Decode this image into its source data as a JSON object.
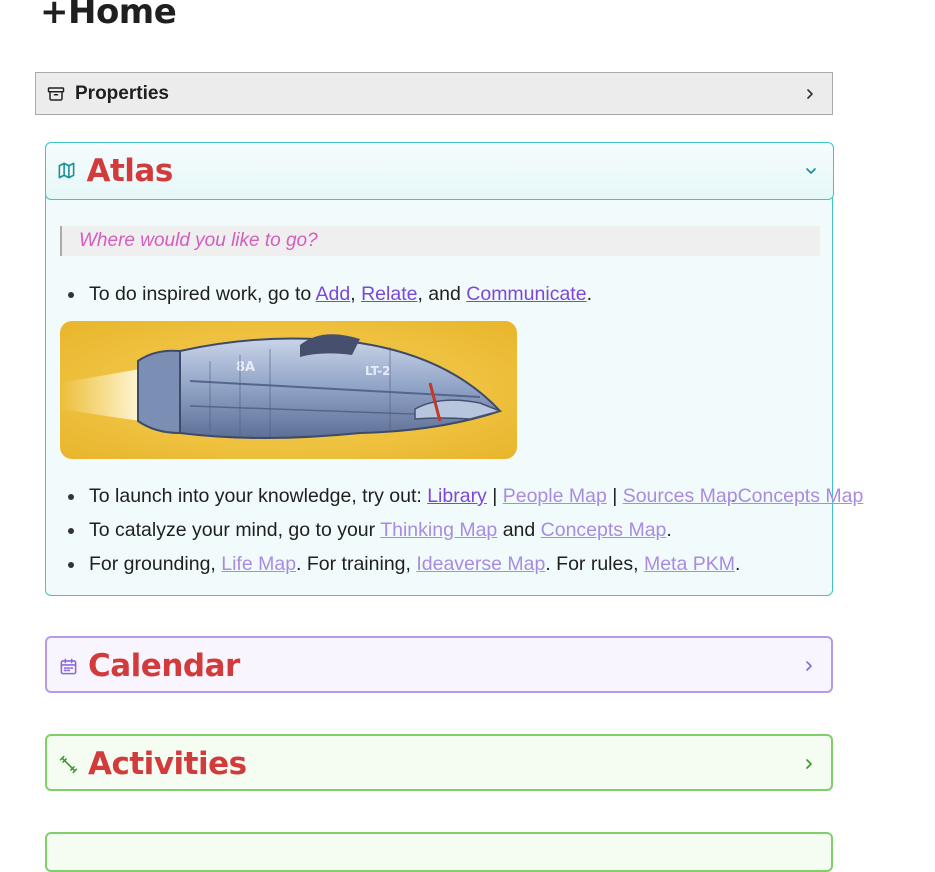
{
  "page": {
    "title": "+Home"
  },
  "properties": {
    "label": "Properties"
  },
  "atlas": {
    "title": "Atlas",
    "quote": "Where would you like to go?",
    "line1": {
      "pre": "To do inspired work, go to ",
      "link1": "Add",
      "sep1": ", ",
      "link2": "Relate",
      "sep2": ", and ",
      "link3": "Communicate",
      "post": "."
    },
    "line2": {
      "pre": "To launch into your knowledge, try out: ",
      "link1": "Library",
      "sep1": " | ",
      "link2": "People Map",
      "sep2": " | ",
      "link3a": "Sources Map",
      "link3b": "Concepts Map",
      "post": "."
    },
    "line3": {
      "pre": "To catalyze your mind, go to your ",
      "link1": "Thinking Map",
      "sep1": " and ",
      "link2": "Concepts Map",
      "post": "."
    },
    "line4": {
      "pre": "For grounding, ",
      "link1": "Life Map",
      "sep1": ". For training, ",
      "link2": "Ideaverse Map",
      "sep2": ". For rules, ",
      "link3": "Meta PKM",
      "post": "."
    }
  },
  "calendar": {
    "title": "Calendar"
  },
  "activities": {
    "title": "Activities"
  },
  "colors": {
    "heading_red": "#d23b3b",
    "atlas_border": "#3ec5c9",
    "calendar_border": "#b49ae8",
    "activities_border": "#7fd06b",
    "link": "#7c48d8",
    "quote_text": "#d45dbf"
  },
  "icons": {
    "properties": "archive-icon",
    "atlas": "map-icon",
    "calendar": "calendar-icon",
    "activities": "dumbbell-icon",
    "collapsed": "chevron-right-icon",
    "expanded": "chevron-down-icon"
  }
}
